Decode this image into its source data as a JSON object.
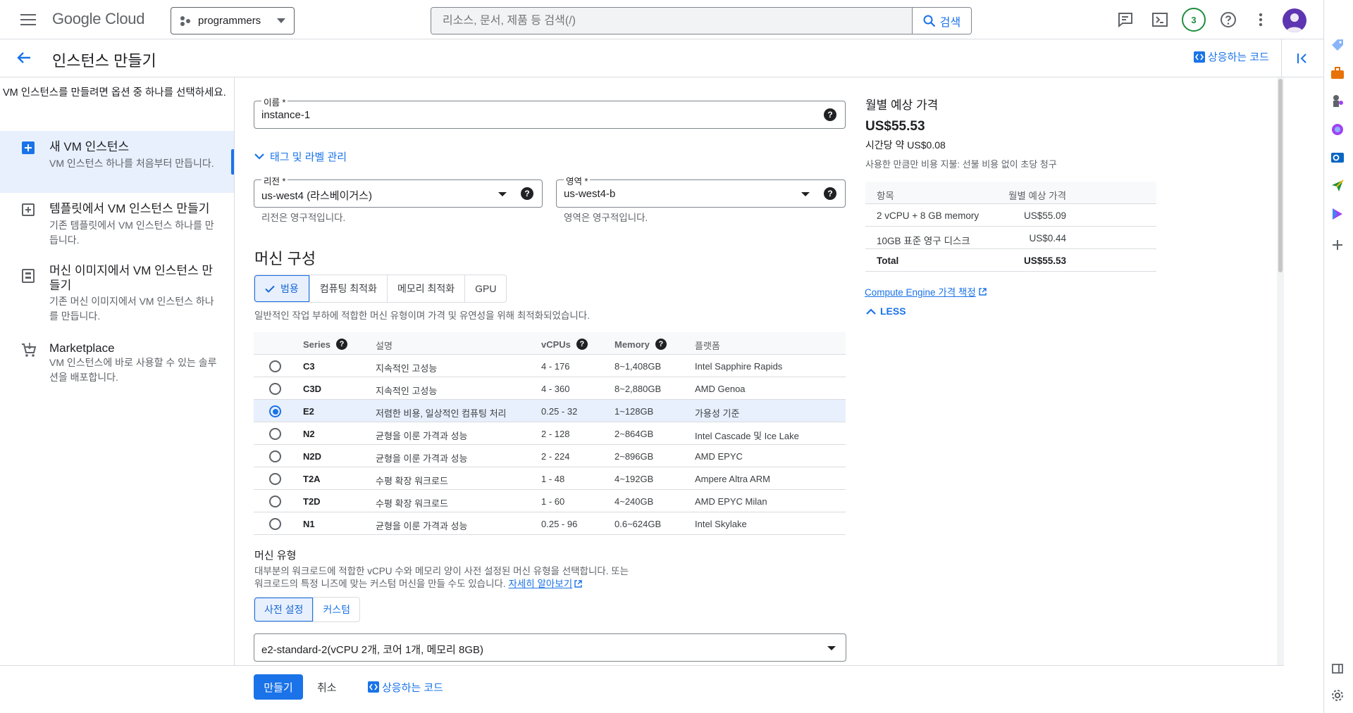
{
  "topbar": {
    "logo_google": "Google",
    "logo_cloud": "Cloud",
    "project": "programmers",
    "search_placeholder": "리소스, 문서, 제품 등 검색(/)",
    "search_button": "검색",
    "notification_count": "3"
  },
  "header": {
    "title": "인스턴스 만들기",
    "equivalent_code": "상응하는 코드"
  },
  "left_nav": {
    "intro": "VM 인스턴스를 만들려면 옵션 중 하나를 선택하세요.",
    "options": [
      {
        "title": "새 VM 인스턴스",
        "desc": "VM 인스턴스 하나를 처음부터 만듭니다."
      },
      {
        "title": "템플릿에서 VM 인스턴스 만들기",
        "desc": "기존 템플릿에서 VM 인스턴스 하나를 만듭니다."
      },
      {
        "title": "머신 이미지에서 VM 인스턴스 만들기",
        "desc": "기존 머신 이미지에서 VM 인스턴스 하나를 만듭니다."
      },
      {
        "title": "Marketplace",
        "desc": "VM 인스턴스에 바로 사용할 수 있는 솔루션을 배포합니다."
      }
    ]
  },
  "form": {
    "name_label": "이름 *",
    "name_value": "instance-1",
    "tags_toggle": "태그 및 라벨 관리",
    "region_label": "리전 *",
    "region_value": "us-west4 (라스베이거스)",
    "region_hint": "리전은 영구적입니다.",
    "zone_label": "영역 *",
    "zone_value": "us-west4-b",
    "zone_hint": "영역은 영구적입니다."
  },
  "machine": {
    "title": "머신 구성",
    "tabs": [
      "범용",
      "컴퓨팅 최적화",
      "메모리 최적화",
      "GPU"
    ],
    "family_desc": "일반적인 작업 부하에 적합한 머신 유형이며 가격 및 유연성을 위해 최적화되었습니다.",
    "columns": {
      "series": "Series",
      "desc": "설명",
      "vcpus": "vCPUs",
      "memory": "Memory",
      "platform": "플랫폼"
    },
    "rows": [
      {
        "series": "C3",
        "desc": "지속적인 고성능",
        "vcpus": "4 - 176",
        "memory": "8~1,408GB",
        "platform": "Intel Sapphire Rapids"
      },
      {
        "series": "C3D",
        "desc": "지속적인 고성능",
        "vcpus": "4 - 360",
        "memory": "8~2,880GB",
        "platform": "AMD Genoa"
      },
      {
        "series": "E2",
        "desc": "저렴한 비용, 일상적인 컴퓨팅 처리",
        "vcpus": "0.25 - 32",
        "memory": "1~128GB",
        "platform": "가용성 기준"
      },
      {
        "series": "N2",
        "desc": "균형을 이룬 가격과 성능",
        "vcpus": "2 - 128",
        "memory": "2~864GB",
        "platform": "Intel Cascade 및 Ice Lake"
      },
      {
        "series": "N2D",
        "desc": "균형을 이룬 가격과 성능",
        "vcpus": "2 - 224",
        "memory": "2~896GB",
        "platform": "AMD EPYC"
      },
      {
        "series": "T2A",
        "desc": "수평 확장 워크로드",
        "vcpus": "1 - 48",
        "memory": "4~192GB",
        "platform": "Ampere Altra ARM"
      },
      {
        "series": "T2D",
        "desc": "수평 확장 워크로드",
        "vcpus": "1 - 60",
        "memory": "4~240GB",
        "platform": "AMD EPYC Milan"
      },
      {
        "series": "N1",
        "desc": "균형을 이룬 가격과 성능",
        "vcpus": "0.25 - 96",
        "memory": "0.6~624GB",
        "platform": "Intel Skylake"
      }
    ],
    "selected_series": "E2",
    "type_title": "머신 유형",
    "type_desc_1": "대부분의 워크로드에 적합한 vCPU 수와 메모리 양이 사전 설정된 머신 유형을 선택합니다. 또는",
    "type_desc_2": "워크로드의 특정 니즈에 맞는 커스텀 머신을 만들 수도 있습니다.",
    "learn_more": "자세히 알아보기",
    "preset_tab": "사전 설정",
    "custom_tab": "커스텀",
    "machine_type_value": "e2-standard-2(vCPU 2개, 코어 1개, 메모리 8GB)"
  },
  "actions": {
    "create": "만들기",
    "cancel": "취소",
    "equivalent_code": "상응하는 코드"
  },
  "pricing": {
    "title": "월별 예상 가격",
    "monthly": "US$55.53",
    "hourly": "시간당 약 US$0.08",
    "note": "사용한 만큼만 비용 지불: 선불 비용 없이 초당 청구",
    "head_item": "항목",
    "head_price": "월별 예상 가격",
    "rows": [
      {
        "item": "2 vCPU + 8 GB memory",
        "price": "US$55.09"
      },
      {
        "item": "10GB 표준 영구 디스크",
        "price": "US$0.44"
      }
    ],
    "total_label": "Total",
    "total_value": "US$55.53",
    "link": "Compute Engine 가격 책정",
    "less": "LESS"
  }
}
